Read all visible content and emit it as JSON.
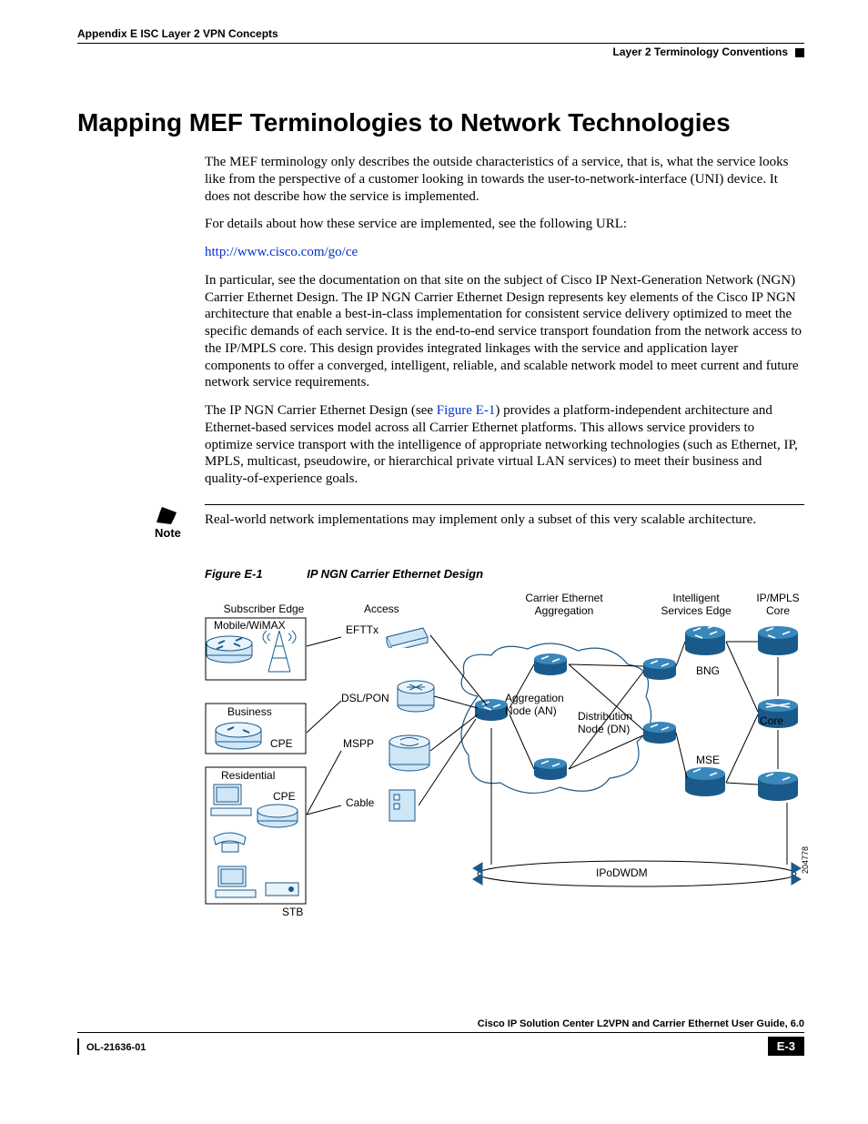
{
  "header": {
    "appendix": "Appendix E      ISC Layer 2 VPN Concepts",
    "right": "Layer 2 Terminology Conventions"
  },
  "section_title": "Mapping MEF Terminologies to Network Technologies",
  "paragraphs": {
    "p1": "The MEF terminology only describes the outside characteristics of a service, that is, what the service looks like from the perspective of a customer looking in towards the user-to-network-interface (UNI) device. It does not describe how the service is implemented.",
    "p2": "For details about how these service are implemented, see the following URL:",
    "link": "http://www.cisco.com/go/ce",
    "p3": "In particular, see the documentation on that site on the subject of Cisco IP Next-Generation Network (NGN) Carrier Ethernet Design. The IP NGN Carrier Ethernet Design represents key elements of the Cisco IP NGN architecture that enable a best-in-class implementation for consistent service delivery optimized to meet the specific demands of each service. It is the end-to-end service transport foundation from the network access to the IP/MPLS core. This design provides integrated linkages with the service and application layer components to offer a converged, intelligent, reliable, and scalable network model to meet current and future network service requirements.",
    "p4a": "The IP NGN Carrier Ethernet Design (see ",
    "p4link": "Figure E-1",
    "p4b": ") provides a platform-independent architecture and Ethernet-based services model across all Carrier Ethernet platforms. This allows service providers to optimize service transport with the intelligence of appropriate networking technologies (such as Ethernet, IP, MPLS, multicast, pseudowire, or hierarchical private virtual LAN services) to meet their business and quality-of-experience goals."
  },
  "note": {
    "label": "Note",
    "text": "Real-world network implementations may implement only a subset of this very scalable architecture."
  },
  "figure": {
    "num": "Figure E-1",
    "title": "IP NGN Carrier Ethernet Design",
    "cols": {
      "subscriber": "Subscriber Edge",
      "access": "Access",
      "aggregation": "Carrier Ethernet Aggregation",
      "ise": "Intelligent Services Edge",
      "core": "IP/MPLS Core"
    },
    "labels": {
      "mobile": "Mobile/WiMAX",
      "business": "Business",
      "cpe1": "CPE",
      "residential": "Residential",
      "cpe2": "CPE",
      "stb": "STB",
      "efttx": "EFTTx",
      "dslpon": "DSL/PON",
      "mspp": "MSPP",
      "cable": "Cable",
      "an": "Aggregation Node (AN)",
      "dn": "Distribution Node (DN)",
      "bng": "BNG",
      "mse": "MSE",
      "core_lbl": "Core",
      "ipodwdm": "IPoDWDM",
      "idnum": "204778"
    }
  },
  "footer": {
    "guide": "Cisco IP Solution Center L2VPN and Carrier Ethernet User Guide, 6.0",
    "ol": "OL-21636-01",
    "page": "E-3"
  }
}
